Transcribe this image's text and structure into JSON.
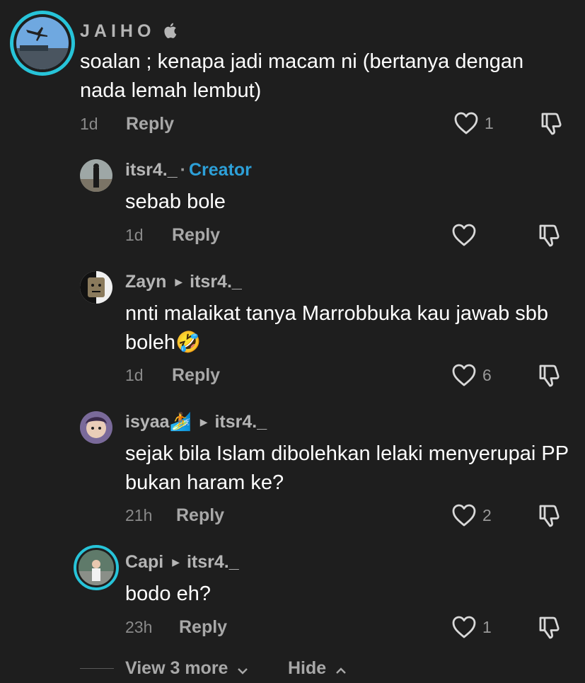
{
  "comments": [
    {
      "username": "JAIHO",
      "text": "soalan ; kenapa jadi macam ni (bertanya dengan nada lemah lembut)",
      "time": "1d",
      "reply_label": "Reply",
      "likes": "1"
    },
    {
      "username": "itsr4._",
      "badge": "Creator",
      "text": "sebab bole",
      "time": "1d",
      "reply_label": "Reply",
      "likes": ""
    },
    {
      "username": "Zayn",
      "reply_to": "itsr4._",
      "text": "nnti malaikat tanya Marrobbuka kau jawab sbb boleh🤣",
      "time": "1d",
      "reply_label": "Reply",
      "likes": "6"
    },
    {
      "username": "isyaa🏄",
      "reply_to": "itsr4._",
      "text": "sejak bila Islam dibolehkan lelaki menyerupai PP bukan haram ke?",
      "time": "21h",
      "reply_label": "Reply",
      "likes": "2"
    },
    {
      "username": "Capi",
      "reply_to": "itsr4._",
      "text": "bodo eh?",
      "time": "23h",
      "reply_label": "Reply",
      "likes": "1"
    }
  ],
  "footer": {
    "view_more": "View 3 more",
    "hide": "Hide"
  },
  "colors": {
    "background": "#1e1e1e",
    "creator_badge": "#2da0d8",
    "story_ring": "#27c4d9"
  },
  "icons": {
    "like": "heart-outline-icon",
    "dislike": "thumbs-down-icon",
    "apple": "apple-icon"
  }
}
